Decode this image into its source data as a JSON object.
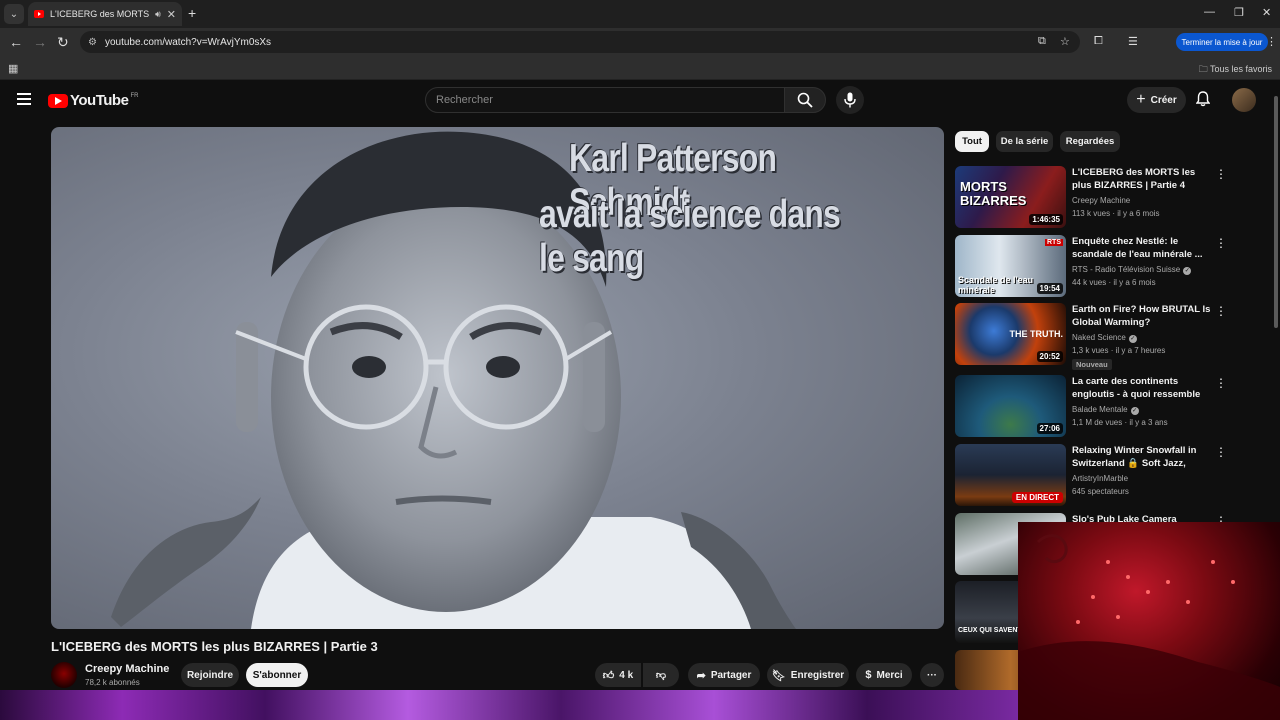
{
  "browser": {
    "tab_title": "L'ICEBERG des MORTS les p",
    "url": "youtube.com/watch?v=WrAvjYm0sXs",
    "update_button": "Terminer la mise à jour",
    "all_bookmarks": "Tous les favoris"
  },
  "header": {
    "logo_text": "YouTube",
    "country_code": "FR",
    "search_placeholder": "Rechercher",
    "create_label": "Créer"
  },
  "player": {
    "overlay_line1": "Karl Patterson Schmidt",
    "overlay_line2": "avait la science dans le sang"
  },
  "video": {
    "title": "L'ICEBERG des MORTS les plus BIZARRES | Partie 3",
    "channel": "Creepy Machine",
    "subscribers": "78,2 k abonnés",
    "join_label": "Rejoindre",
    "subscribe_label": "S'abonner",
    "likes": "4 k",
    "share_label": "Partager",
    "save_label": "Enregistrer",
    "thanks_label": "Merci"
  },
  "chips": [
    "Tout",
    "De la série",
    "Regardées"
  ],
  "recommendations": [
    {
      "title": "L'ICEBERG des MORTS les plus BIZARRES | Partie 4",
      "channel": "Creepy Machine",
      "meta": "113 k vues · il y a 6 mois",
      "duration": "1:46:35",
      "thumb_text": "MORTS BIZARRES"
    },
    {
      "title": "Enquête chez Nestlé: le scandale de l'eau minérale ...",
      "channel": "RTS - Radio Télévision Suisse",
      "meta": "44 k vues · il y a 6 mois",
      "duration": "19:54",
      "thumb_text": "Scandale de l'eau minérale",
      "thumb_badge": "RTS"
    },
    {
      "title": "Earth on Fire? How BRUTAL Is Global Warming?",
      "channel": "Naked Science",
      "meta": "1,3 k vues · il y a 7 heures",
      "duration": "20:52",
      "thumb_text": "THE TRUTH.",
      "badge": "Nouveau"
    },
    {
      "title": "La carte des continents engloutis - à quoi ressemble la...",
      "channel": "Balade Mentale",
      "meta": "1,1 M de vues · il y a 3 ans",
      "duration": "27:06"
    },
    {
      "title": "Relaxing Winter Snowfall in Switzerland 🔒 Soft Jazz, Coz...",
      "channel": "ArtistryInMarble",
      "meta": "645 spectateurs",
      "live": "EN DIRECT"
    },
    {
      "title": "Slo's Pub Lake Camera",
      "channel": "",
      "meta": ""
    },
    {
      "title": "",
      "channel": "",
      "meta": "",
      "thumb_text": "CEUX QUI SAVENT"
    },
    {
      "title": "",
      "channel": "",
      "meta": ""
    }
  ]
}
